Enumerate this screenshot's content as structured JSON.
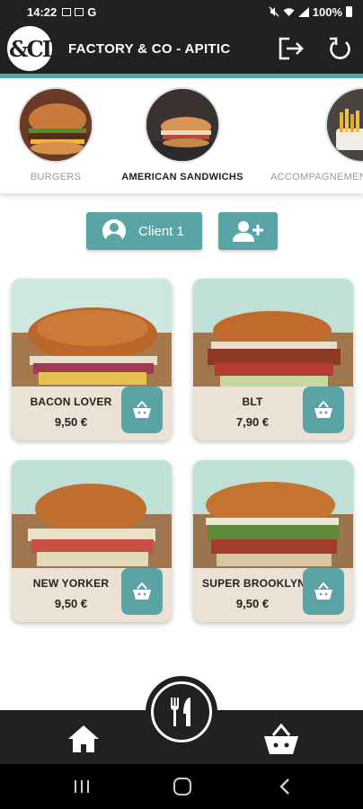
{
  "status_bar": {
    "time": "14:22",
    "carrier_glyph": "G",
    "battery": "100%",
    "icons": [
      "image-icon",
      "mute-icon",
      "wifi-icon",
      "signal-icon",
      "battery-icon"
    ]
  },
  "header": {
    "logo_text": "&CI",
    "title": "FACTORY & CO - APITIC",
    "icons": [
      "logout-icon",
      "refresh-icon"
    ]
  },
  "categories": [
    {
      "label": "BURGERS",
      "active": false
    },
    {
      "label": "AMERICAN SANDWICHS",
      "active": true
    },
    {
      "label": "ACCOMPAGNEMEN",
      "active": false
    }
  ],
  "client": {
    "label": "Client 1",
    "icons": [
      "user-avatar-icon",
      "add-user-icon"
    ]
  },
  "products": [
    {
      "name": "BACON LOVER",
      "price": "9,50 €"
    },
    {
      "name": "BLT",
      "price": "7,90 €"
    },
    {
      "name": "NEW YORKER",
      "price": "9,50 €"
    },
    {
      "name": "SUPER BROOKLYN",
      "price": "9,50 €"
    }
  ],
  "bottom_nav": {
    "icons": [
      "home-icon",
      "cutlery-icon",
      "basket-icon"
    ]
  },
  "colors": {
    "accent": "#5aa4a6",
    "dark": "#212121",
    "card_bg": "#efe6da"
  }
}
